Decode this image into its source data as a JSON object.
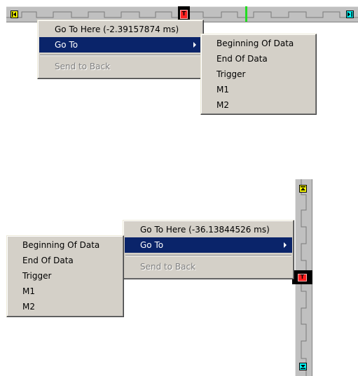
{
  "top_context": {
    "menu": {
      "go_to_here": "Go To Here (-2.39157874 ms)",
      "go_to": "Go To",
      "send_to_back": "Send to Back"
    },
    "submenu": [
      "Beginning Of Data",
      "End Of Data",
      "Trigger",
      "M1",
      "M2"
    ],
    "trigger_label": "T"
  },
  "bottom_context": {
    "menu": {
      "go_to_here": "Go To Here (-36.13844526 ms)",
      "go_to": "Go To",
      "send_to_back": "Send to Back"
    },
    "submenu": [
      "Beginning Of Data",
      "End Of Data",
      "Trigger",
      "M1",
      "M2"
    ],
    "trigger_label": "T"
  },
  "colors": {
    "menu_bg": "#d4d0c8",
    "selection": "#0a246a",
    "disabled_text": "#808080",
    "strip_bg": "#c0c0c0",
    "trigger_red": "#ff2020",
    "marker_green": "#22dd22",
    "start_marker": "#ffff00",
    "end_marker": "#00ffff"
  },
  "icons": {
    "start": "skip-to-start-icon",
    "end": "skip-to-end-icon",
    "trigger": "trigger-marker-icon"
  }
}
